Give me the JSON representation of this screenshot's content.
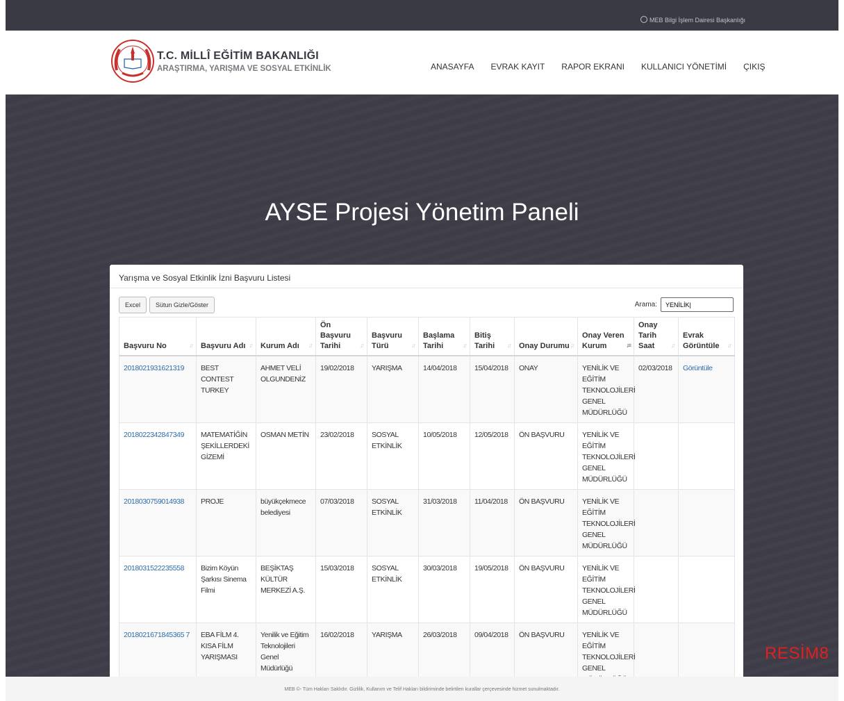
{
  "topbar": {
    "credit": "MEB Bilgi İşlem Dairesi Başkanlığı"
  },
  "header": {
    "brand_line1": "T.C. MİLLÎ EĞİTİM BAKANLIĞI",
    "brand_line2": "ARAŞTIRMA, YARIŞMA VE SOSYAL ETKİNLİK",
    "logo_text": "MİLLÎ EĞİTİM BAKANLIĞI",
    "nav": [
      "ANASAYFA",
      "EVRAK KAYIT",
      "RAPOR EKRANI",
      "KULLANICI YÖNETİMİ",
      "ÇIKIŞ"
    ]
  },
  "hero": {
    "title": "AYSE Projesi Yönetim Paneli"
  },
  "panel": {
    "title": "Yarışma ve Sosyal Etkinlik İzni Başvuru Listesi",
    "excel_label": "Excel",
    "toggle_label": "Sütun Gizle/Göster",
    "search_label": "Arama:",
    "search_value": "YENİLİK|",
    "columns": [
      "Başvuru No",
      "Başvuru Adı",
      "Kurum Adı",
      "Ön Başvuru Tarihi",
      "Başvuru Türü",
      "Başlama Tarihi",
      "Bitiş Tarihi",
      "Onay Durumu",
      "Onay Veren Kurum",
      "Onay Tarih Saat",
      "Evrak Görüntüle"
    ],
    "rows": [
      [
        "2018021931621319",
        "BEST CONTEST TURKEY",
        "AHMET VELİ OLGUNDENİZ",
        "19/02/2018",
        "YARIŞMA",
        "14/04/2018",
        "15/04/2018",
        "ONAY",
        "YENİLİK VE EĞİTİM TEKNOLOJİLERİ GENEL MÜDÜRLÜĞÜ",
        "02/03/2018",
        "Görüntüle"
      ],
      [
        "2018022342847349",
        "MATEMATİĞİN ŞEKİLLERDEKİ GİZEMİ",
        "OSMAN METİN",
        "23/02/2018",
        "SOSYAL ETKİNLİK",
        "10/05/2018",
        "12/05/2018",
        "ÖN BAŞVURU",
        "YENİLİK VE EĞİTİM TEKNOLOJİLERİ GENEL MÜDÜRLÜĞÜ",
        "",
        ""
      ],
      [
        "2018030759014938",
        "PROJE",
        "büyükçekmece belediyesi",
        "07/03/2018",
        "SOSYAL ETKİNLİK",
        "31/03/2018",
        "11/04/2018",
        "ÖN BAŞVURU",
        "YENİLİK VE EĞİTİM TEKNOLOJİLERİ GENEL MÜDÜRLÜĞÜ",
        "",
        ""
      ],
      [
        "2018031522235558",
        "Bizim Köyün Şarkısı Sinema Filmi",
        "BEŞİKTAŞ KÜLTÜR MERKEZİ A.Ş.",
        "15/03/2018",
        "SOSYAL ETKİNLİK",
        "30/03/2018",
        "19/05/2018",
        "ÖN BAŞVURU",
        "YENİLİK VE EĞİTİM TEKNOLOJİLERİ GENEL MÜDÜRLÜĞÜ",
        "",
        ""
      ],
      [
        "2018021671845365 7",
        "EBA FİLM 4. KISA FİLM YARIŞMASI",
        "Yenilik ve Eğitim Teknolojileri Genel Müdürlüğü",
        "16/02/2018",
        "YARIŞMA",
        "26/03/2018",
        "09/04/2018",
        "ÖN BAŞVURU",
        "YENİLİK VE EĞİTİM TEKNOLOJİLERİ GENEL MÜDÜRLÜĞÜ",
        "",
        ""
      ]
    ]
  },
  "footer": {
    "text": "MEB ©- Tüm Hakları Saklıdır. Gizlilik, Kullanım ve Telif Hakları bildiriminde belirtilen kurallar çerçevesinde hizmet sunulmaktadır."
  },
  "watermark": "RESİM8"
}
